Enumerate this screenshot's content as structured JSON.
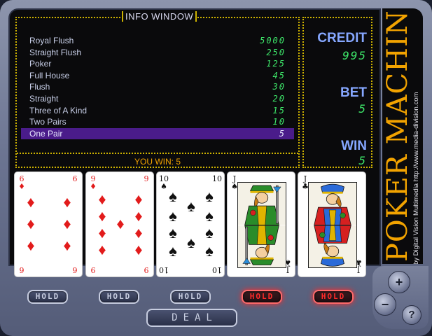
{
  "info_window": {
    "title": "INFO WINDOW",
    "paytable": [
      {
        "hand": "Royal Flush",
        "payout": "5000"
      },
      {
        "hand": "Straight Flush",
        "payout": "250"
      },
      {
        "hand": "Poker",
        "payout": "125"
      },
      {
        "hand": "Full House",
        "payout": "45"
      },
      {
        "hand": "Flush",
        "payout": "30"
      },
      {
        "hand": "Straight",
        "payout": "20"
      },
      {
        "hand": "Three of A Kind",
        "payout": "15"
      },
      {
        "hand": "Two Pairs",
        "payout": "10"
      },
      {
        "hand": "One Pair",
        "payout": "5"
      }
    ],
    "highlighted_hand": "One Pair",
    "you_win": "YOU WIN: 5"
  },
  "stats": {
    "credit_label": "CREDIT",
    "credit_value": "995",
    "bet_label": "BET",
    "bet_value": "5",
    "win_label": "WIN",
    "win_value": "5"
  },
  "brand": {
    "title": "POKER MACHINE",
    "subtitle": "by Digital Vision Multimedia http://www.media-division.com"
  },
  "cards": [
    {
      "rank": "6",
      "suit": "diamonds",
      "suit_symbol": "♦",
      "color": "red",
      "held": false
    },
    {
      "rank": "9",
      "suit": "diamonds",
      "suit_symbol": "♦",
      "color": "red",
      "held": false
    },
    {
      "rank": "10",
      "suit": "spades",
      "suit_symbol": "♠",
      "color": "black",
      "held": false
    },
    {
      "rank": "J",
      "suit": "spades",
      "suit_symbol": "♠",
      "color": "black",
      "held": true
    },
    {
      "rank": "J",
      "suit": "clubs",
      "suit_symbol": "♣",
      "color": "black",
      "held": true
    }
  ],
  "controls": {
    "hold_label": "HOLD",
    "deal_label": "DEAL",
    "bet_up_label": "+",
    "bet_down_label": "−",
    "help_label": "?"
  },
  "colors": {
    "payout_green": "#3ee86a",
    "highlight_purple": "#4a1c8a",
    "brand_orange": "#f2a300",
    "dotted_border": "#cdb200",
    "hold_active_red": "#ff2a2a"
  }
}
